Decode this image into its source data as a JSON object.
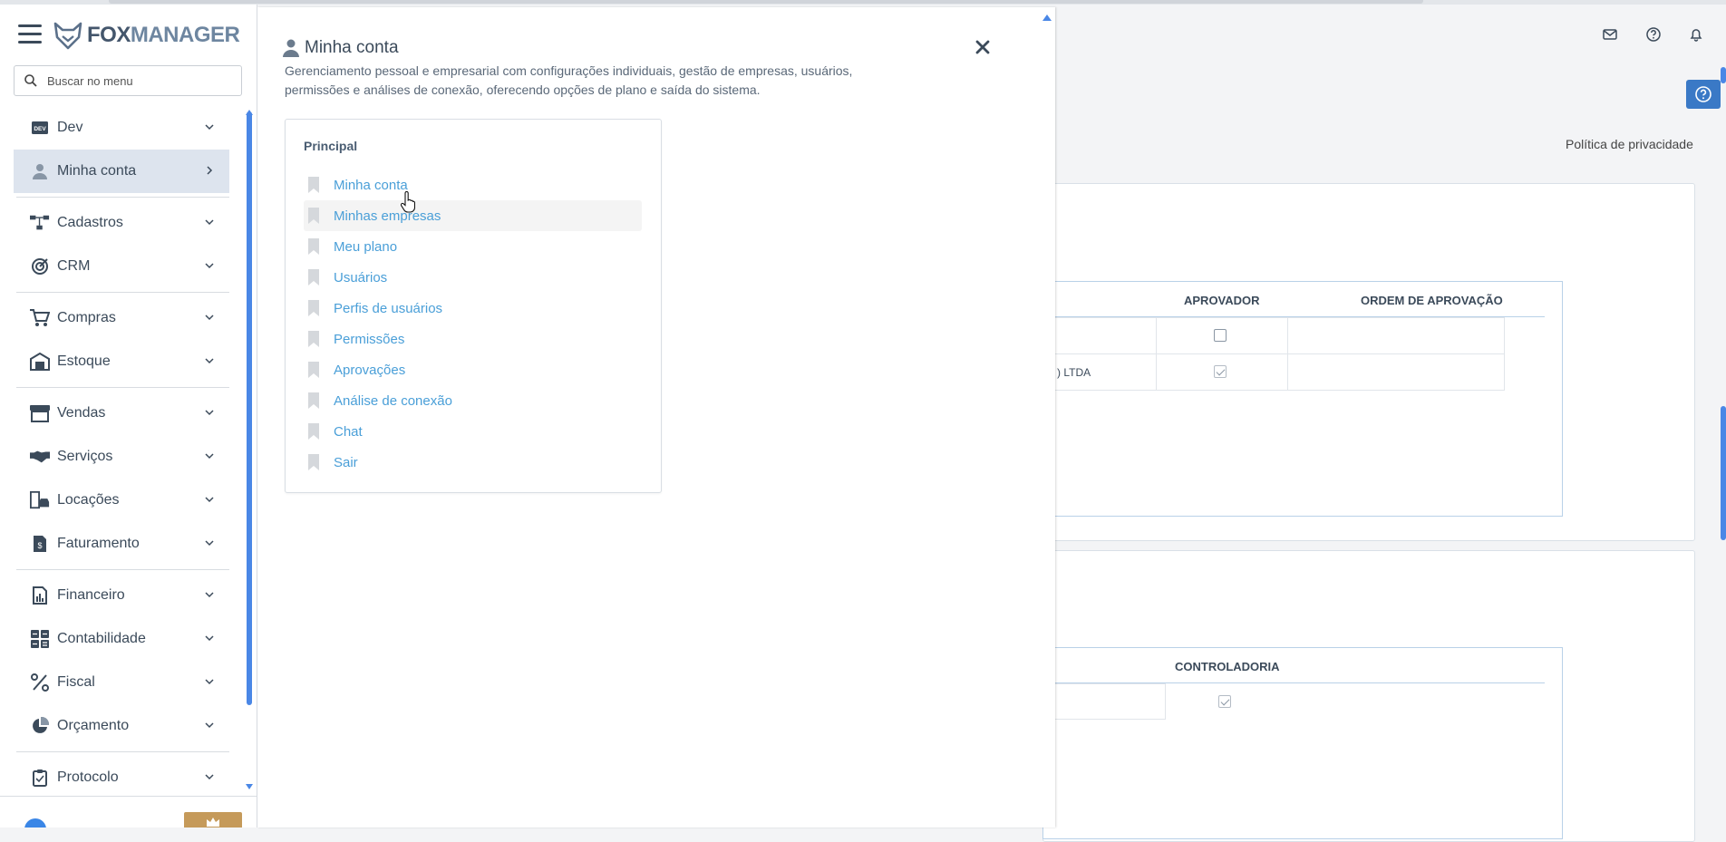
{
  "app": {
    "logo_fox": "FOX",
    "logo_manager": "MANAGER"
  },
  "search": {
    "placeholder": "Buscar no menu"
  },
  "sidebar": {
    "items": [
      {
        "label": "Dev",
        "icon": "dev-icon"
      },
      {
        "label": "Minha conta",
        "icon": "user-icon",
        "active": true
      },
      {
        "label": "Cadastros",
        "icon": "sitemap-icon"
      },
      {
        "label": "CRM",
        "icon": "target-icon"
      },
      {
        "label": "Compras",
        "icon": "cart-icon"
      },
      {
        "label": "Estoque",
        "icon": "warehouse-icon"
      },
      {
        "label": "Vendas",
        "icon": "store-icon"
      },
      {
        "label": "Serviços",
        "icon": "handshake-icon"
      },
      {
        "label": "Locações",
        "icon": "building-car-icon"
      },
      {
        "label": "Faturamento",
        "icon": "invoice-icon"
      },
      {
        "label": "Financeiro",
        "icon": "report-chart-icon"
      },
      {
        "label": "Contabilidade",
        "icon": "calculator-icon"
      },
      {
        "label": "Fiscal",
        "icon": "percent-icon"
      },
      {
        "label": "Orçamento",
        "icon": "pie-chart-icon"
      },
      {
        "label": "Protocolo",
        "icon": "clipboard-icon"
      }
    ]
  },
  "panel": {
    "title": "Minha conta",
    "description": "Gerenciamento pessoal e empresarial com configurações individuais, gestão de empresas, usuários, permissões e análises de conexão, oferecendo opções de plano e saída do sistema.",
    "section_title": "Principal",
    "links": [
      "Minha conta",
      "Minhas empresas",
      "Meu plano",
      "Usuários",
      "Perfis de usuários",
      "Permissões",
      "Aprovações",
      "Análise de conexão",
      "Chat",
      "Sair"
    ]
  },
  "background": {
    "privacy_link": "Política de privacidade",
    "table1": {
      "col_aprovador": "APROVADOR",
      "col_ordem": "ORDEM DE APROVAÇÃO",
      "row2_text": ") LTDA"
    },
    "table2": {
      "col_controladoria": "CONTROLADORIA"
    }
  },
  "colors": {
    "accent": "#4a87e6",
    "link": "#4a9fd8",
    "active_bg": "#dde4ee",
    "help_button": "#3a79c6",
    "premium": "#c59a5a"
  }
}
